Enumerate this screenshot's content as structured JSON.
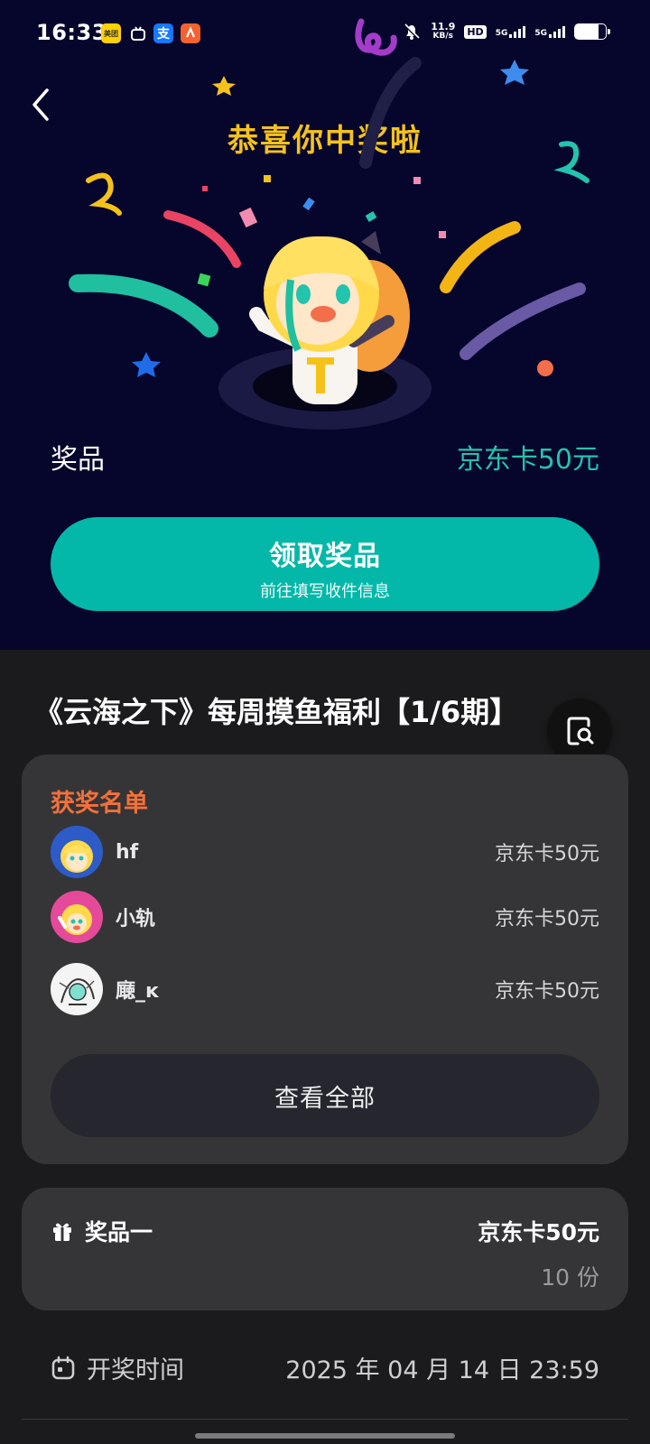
{
  "status_bar": {
    "time": "16:33",
    "apps": [
      "美团",
      "bilibili-icon",
      "支",
      "sogou-icon"
    ],
    "net_speed_top": "11.9",
    "net_speed_unit": "KB/s",
    "hd": "HD",
    "net1": "5G",
    "net2": "5G"
  },
  "header": {
    "congrats": "恭喜你中奖啦"
  },
  "prize": {
    "label": "奖品",
    "value": "京东卡50元"
  },
  "claim_button": {
    "title": "领取奖品",
    "subtitle": "前往填写收件信息"
  },
  "event_title": "《云海之下》每周摸鱼福利【1/6期】",
  "winners": {
    "heading": "获奖名单",
    "list": [
      {
        "name": "hf",
        "prize": "京东卡50元"
      },
      {
        "name": "小轨",
        "prize": "京东卡50元"
      },
      {
        "name": "廰_ĸ",
        "prize": "京东卡50元"
      }
    ],
    "view_all": "查看全部"
  },
  "prize_card": {
    "name": "奖品一",
    "value": "京东卡50元",
    "count": "10 份"
  },
  "draw_time": {
    "label": "开奖时间",
    "value": "2025 年 04 月 14 日 23:59"
  },
  "colors": {
    "top_bg": "#06052c",
    "accent_teal": "#03b8a8",
    "congrats_gold": "#f5c21b",
    "winners_orange": "#f2703a",
    "card_bg": "#353537"
  }
}
